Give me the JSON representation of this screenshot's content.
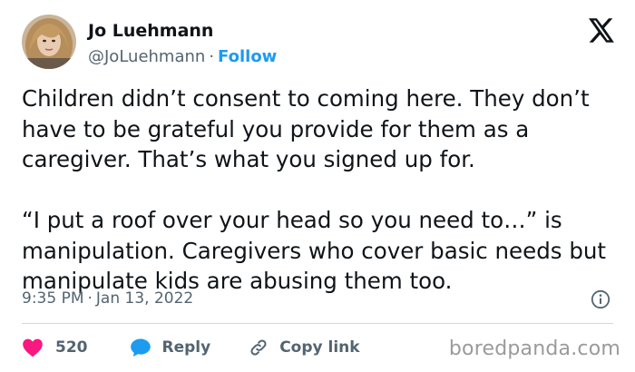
{
  "author": {
    "display_name": "Jo Luehmann",
    "handle": "@JoLuehmann",
    "separator": "·",
    "follow_label": "Follow"
  },
  "tweet": {
    "paragraphs": [
      "Children didn’t consent to coming here. They don’t have to be grateful you provide for them as a caregiver. That’s what you signed up for.",
      "“I put a roof over your head so you need to…” is manipulation. Caregivers who cover basic needs but manipulate kids are abusing them too."
    ],
    "time": "9:35 PM",
    "separator": "·",
    "date": "Jan 13, 2022"
  },
  "actions": {
    "like_count": "520",
    "reply_label": "Reply",
    "copy_link_label": "Copy link"
  },
  "watermark": "boredpanda.com",
  "icons": {
    "logo": "x-logo-icon",
    "info": "info-icon",
    "like": "heart-icon",
    "reply": "reply-bubble-icon",
    "copy": "link-icon"
  },
  "colors": {
    "accent": "#1d9bf0",
    "like": "#f91880",
    "muted_text": "#536471",
    "text": "#0f1419",
    "divider": "#cfd9de"
  }
}
